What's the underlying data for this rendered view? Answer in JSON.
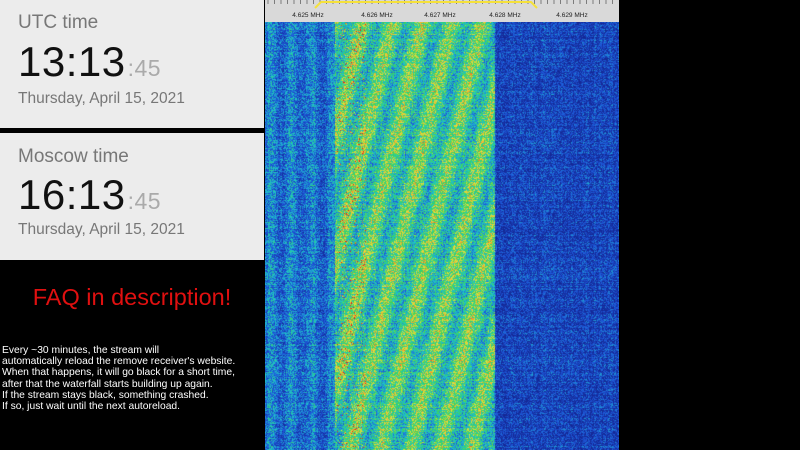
{
  "utc": {
    "label": "UTC time",
    "hours_minutes": "13:13",
    "seconds": "45",
    "date": "Thursday, April 15, 2021"
  },
  "moscow": {
    "label": "Moscow time",
    "hours_minutes": "16:13",
    "seconds": "45",
    "date": "Thursday, April 15, 2021"
  },
  "faq": {
    "heading": "FAQ in description!"
  },
  "notice": {
    "lines": [
      "Every ~30 minutes, the stream will",
      "automatically reload the remove receiver's website.",
      "When that happens, it will go black for a short time,",
      "after that the waterfall starts building up again.",
      "If the stream stays black, something crashed.",
      "If so, just wait until the next autoreload."
    ]
  },
  "waterfall": {
    "frequency_ticks": [
      "4.625 MHz",
      "4.626 MHz",
      "4.627 MHz",
      "4.628 MHz",
      "4.629 MHz"
    ],
    "passband_color": "#f5e13b",
    "colors": {
      "background": "#1c3fb8",
      "signal_low": "#1ec8c8",
      "signal_mid": "#f0e040",
      "signal_high": "#e02020"
    }
  }
}
